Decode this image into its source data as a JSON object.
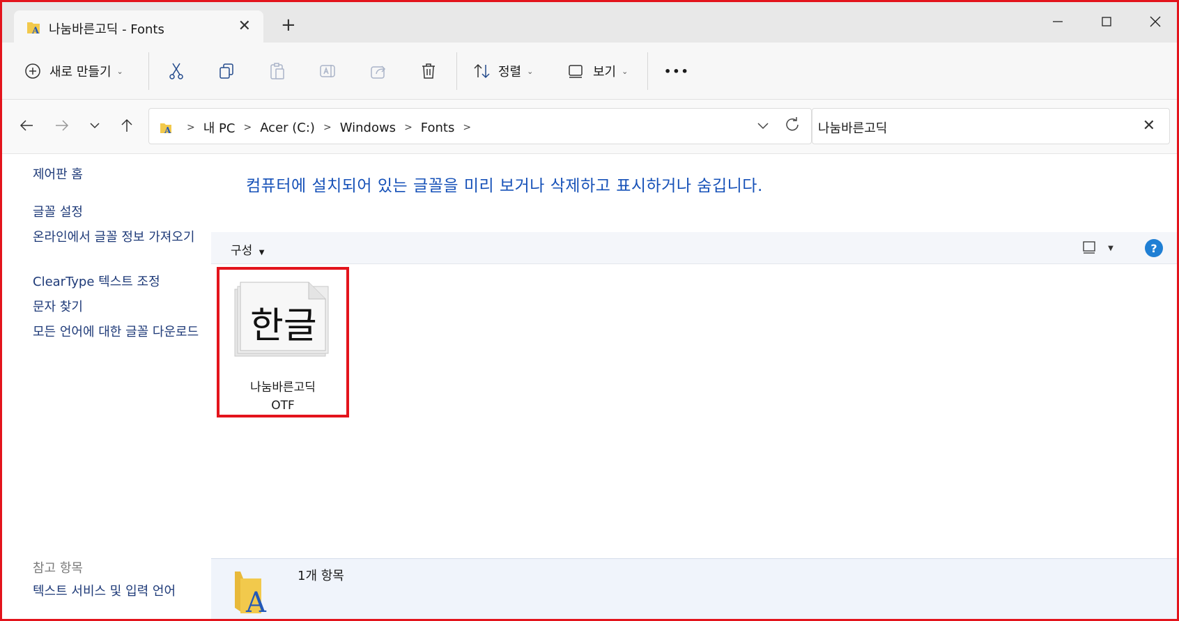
{
  "window": {
    "tab_title": "나눔바른고딕 - Fonts",
    "new_tab_symbol": "+"
  },
  "toolbar": {
    "new_label": "새로 만들기",
    "sort_label": "정렬",
    "view_label": "보기",
    "more_symbol": "•••"
  },
  "address": {
    "breadcrumbs": [
      "내 PC",
      "Acer (C:)",
      "Windows",
      "Fonts"
    ]
  },
  "search": {
    "value": "나눔바른고딕"
  },
  "sidebar": {
    "home": "제어판 홈",
    "links": [
      "글꼴 설정",
      "온라인에서 글꼴 정보 가져오기",
      "ClearType 텍스트 조정",
      "문자 찾기",
      "모든 언어에 대한 글꼴 다운로드"
    ],
    "see_also_title": "참고 항목",
    "see_also_links": [
      "텍스트 서비스 및 입력 언어"
    ]
  },
  "main": {
    "headline": "컴퓨터에 설치되어 있는 글꼴을 미리 보거나 삭제하고 표시하거나 숨깁니다.",
    "organize_label": "구성",
    "help_symbol": "?",
    "font_items": [
      {
        "preview_text": "한글",
        "name": "나눔바른고딕",
        "type": "OTF"
      }
    ]
  },
  "details": {
    "count_text": "1개 항목"
  },
  "colors": {
    "highlight_border": "#e3141c",
    "link": "#1e3a78",
    "headline": "#1651b8",
    "help": "#1f7fd4"
  }
}
